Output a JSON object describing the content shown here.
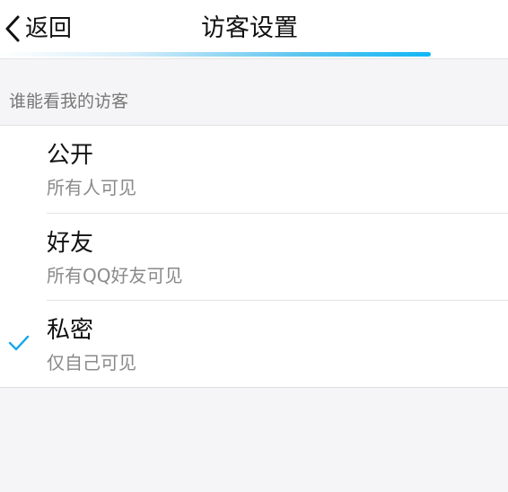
{
  "nav": {
    "back_label": "返回",
    "title": "访客设置",
    "loading_progress": 0.92
  },
  "section": {
    "header": "谁能看我的访客"
  },
  "options": [
    {
      "title": "公开",
      "subtitle": "所有人可见",
      "selected": false
    },
    {
      "title": "好友",
      "subtitle": "所有QQ好友可见",
      "selected": false
    },
    {
      "title": "私密",
      "subtitle": "仅自己可见",
      "selected": true
    }
  ],
  "colors": {
    "accent": "#12b7f5",
    "check": "#1aa8e8",
    "background": "#f5f5f7",
    "text_primary": "#111111",
    "text_secondary": "#8a8a8a"
  },
  "icons": {
    "back": "chevron-left-icon",
    "selected": "checkmark-icon"
  }
}
